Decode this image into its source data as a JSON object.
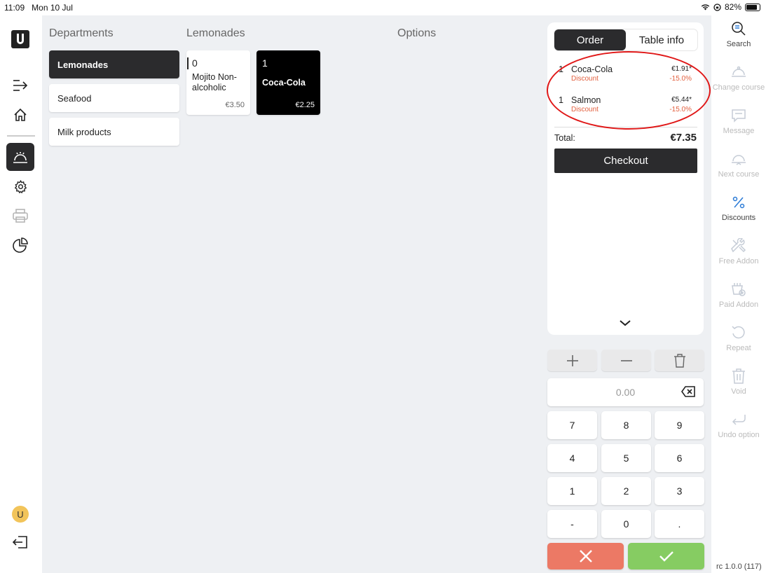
{
  "status_bar": {
    "time": "11:09",
    "date": "Mon 10 Jul",
    "battery": "82%"
  },
  "left_nav": {
    "logo": "U",
    "items": [
      {
        "icon": "menu-arrow-icon",
        "active": false
      },
      {
        "icon": "home-icon",
        "active": false
      },
      {
        "icon": "service-bell-icon",
        "active": true
      },
      {
        "icon": "gear-icon",
        "active": false
      },
      {
        "icon": "printer-icon",
        "active": false,
        "disabled": true
      },
      {
        "icon": "pie-chart-icon",
        "active": false
      }
    ],
    "avatar": "U"
  },
  "columns": {
    "departments": "Departments",
    "products": "Lemonades",
    "options": "Options"
  },
  "departments": [
    {
      "label": "Lemonades",
      "active": true
    },
    {
      "label": "Seafood",
      "active": false
    },
    {
      "label": "Milk products",
      "active": false
    }
  ],
  "products": [
    {
      "qty": "0",
      "name": "Mojito Non-alcoholic",
      "price": "€3.50",
      "active": false
    },
    {
      "qty": "1",
      "name": "Coca-Cola",
      "price": "€2.25",
      "active": true
    }
  ],
  "order": {
    "tabs": [
      {
        "label": "Order",
        "active": true
      },
      {
        "label": "Table info",
        "active": false
      }
    ],
    "lines": [
      {
        "qty": "1",
        "name": "Coca-Cola",
        "price": "€1.91*",
        "discount_label": "Discount",
        "discount_pct": "-15.0%"
      },
      {
        "qty": "1",
        "name": "Salmon",
        "price": "€5.44*",
        "discount_label": "Discount",
        "discount_pct": "-15.0%"
      }
    ],
    "total_label": "Total:",
    "total_value": "€7.35",
    "checkout_label": "Checkout"
  },
  "keypad": {
    "display_value": "0.00",
    "keys": [
      "7",
      "8",
      "9",
      "4",
      "5",
      "6",
      "1",
      "2",
      "3",
      "-",
      "0",
      "."
    ]
  },
  "right_tools": [
    {
      "label": "Search",
      "icon": "search-list-icon",
      "disabled": false
    },
    {
      "label": "Change course",
      "icon": "cloche-icon",
      "disabled": true
    },
    {
      "label": "Message",
      "icon": "message-icon",
      "disabled": true
    },
    {
      "label": "Next course",
      "icon": "cloche-arrow-icon",
      "disabled": true
    },
    {
      "label": "Discounts",
      "icon": "percent-icon",
      "disabled": false
    },
    {
      "label": "Free Addon",
      "icon": "tools-icon",
      "disabled": true
    },
    {
      "label": "Paid Addon",
      "icon": "basket-plus-icon",
      "disabled": true
    },
    {
      "label": "Repeat",
      "icon": "repeat-icon",
      "disabled": true
    },
    {
      "label": "Void",
      "icon": "trash-icon",
      "disabled": true
    },
    {
      "label": "Undo option",
      "icon": "undo-icon",
      "disabled": true
    }
  ],
  "version": "rc 1.0.0 (117)",
  "colors": {
    "dark": "#2b2b2d",
    "discount": "#e2603f",
    "cancel": "#ec7965",
    "ok": "#86cc62",
    "accent": "#2a7ad6",
    "highlight": "#e01818"
  }
}
